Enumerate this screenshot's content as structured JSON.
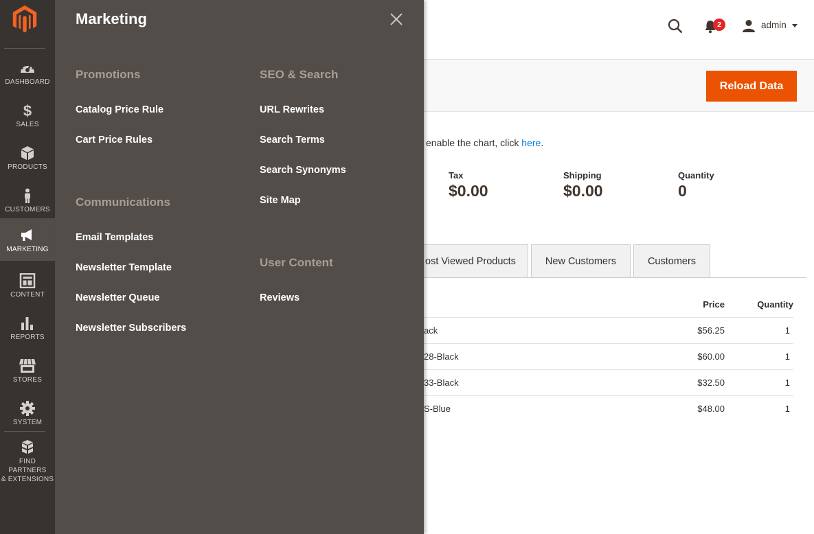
{
  "nav": {
    "items": [
      {
        "label": "DASHBOARD",
        "icon": "dashboard-icon"
      },
      {
        "label": "SALES",
        "icon": "dollar-icon"
      },
      {
        "label": "PRODUCTS",
        "icon": "cube-icon"
      },
      {
        "label": "CUSTOMERS",
        "icon": "person-icon"
      },
      {
        "label": "MARKETING",
        "icon": "megaphone-icon",
        "active": true
      },
      {
        "label": "CONTENT",
        "icon": "layout-icon"
      },
      {
        "label": "REPORTS",
        "icon": "bar-chart-icon"
      },
      {
        "label": "STORES",
        "icon": "storefront-icon"
      },
      {
        "label": "SYSTEM",
        "icon": "gear-icon"
      }
    ],
    "partners_line1": "FIND PARTNERS",
    "partners_line2": "& EXTENSIONS"
  },
  "panel": {
    "title": "Marketing",
    "groups": {
      "promotions": {
        "title": "Promotions",
        "links": [
          "Catalog Price Rule",
          "Cart Price Rules"
        ]
      },
      "communications": {
        "title": "Communications",
        "links": [
          "Email Templates",
          "Newsletter Template",
          "Newsletter Queue",
          "Newsletter Subscribers"
        ]
      },
      "seo": {
        "title": "SEO & Search",
        "links": [
          "URL Rewrites",
          "Search Terms",
          "Search Synonyms",
          "Site Map"
        ]
      },
      "user_content": {
        "title": "User Content",
        "links": [
          "Reviews"
        ]
      }
    }
  },
  "header": {
    "notification_count": "2",
    "username": "admin"
  },
  "actions": {
    "reload_label": "Reload Data"
  },
  "notice": {
    "text": " enable the chart, click ",
    "link": "here",
    "end": "."
  },
  "totals": [
    {
      "label": "Tax",
      "value": "$0.00"
    },
    {
      "label": "Shipping",
      "value": "$0.00"
    },
    {
      "label": "Quantity",
      "value": "0"
    }
  ],
  "tabs": [
    "ost Viewed Products",
    "New Customers",
    "Customers"
  ],
  "table": {
    "headers": {
      "price": "Price",
      "quantity": "Quantity"
    },
    "rows": [
      {
        "name": "ack",
        "price": "$56.25",
        "qty": "1"
      },
      {
        "name": "28-Black",
        "price": "$60.00",
        "qty": "1"
      },
      {
        "name": "33-Black",
        "price": "$32.50",
        "qty": "1"
      },
      {
        "name": "S-Blue",
        "price": "$48.00",
        "qty": "1"
      }
    ]
  },
  "colors": {
    "nav_bg": "#373330",
    "panel_bg": "#524d49",
    "accent": "#eb5202",
    "link": "#007bdb",
    "badge": "#e22626"
  }
}
